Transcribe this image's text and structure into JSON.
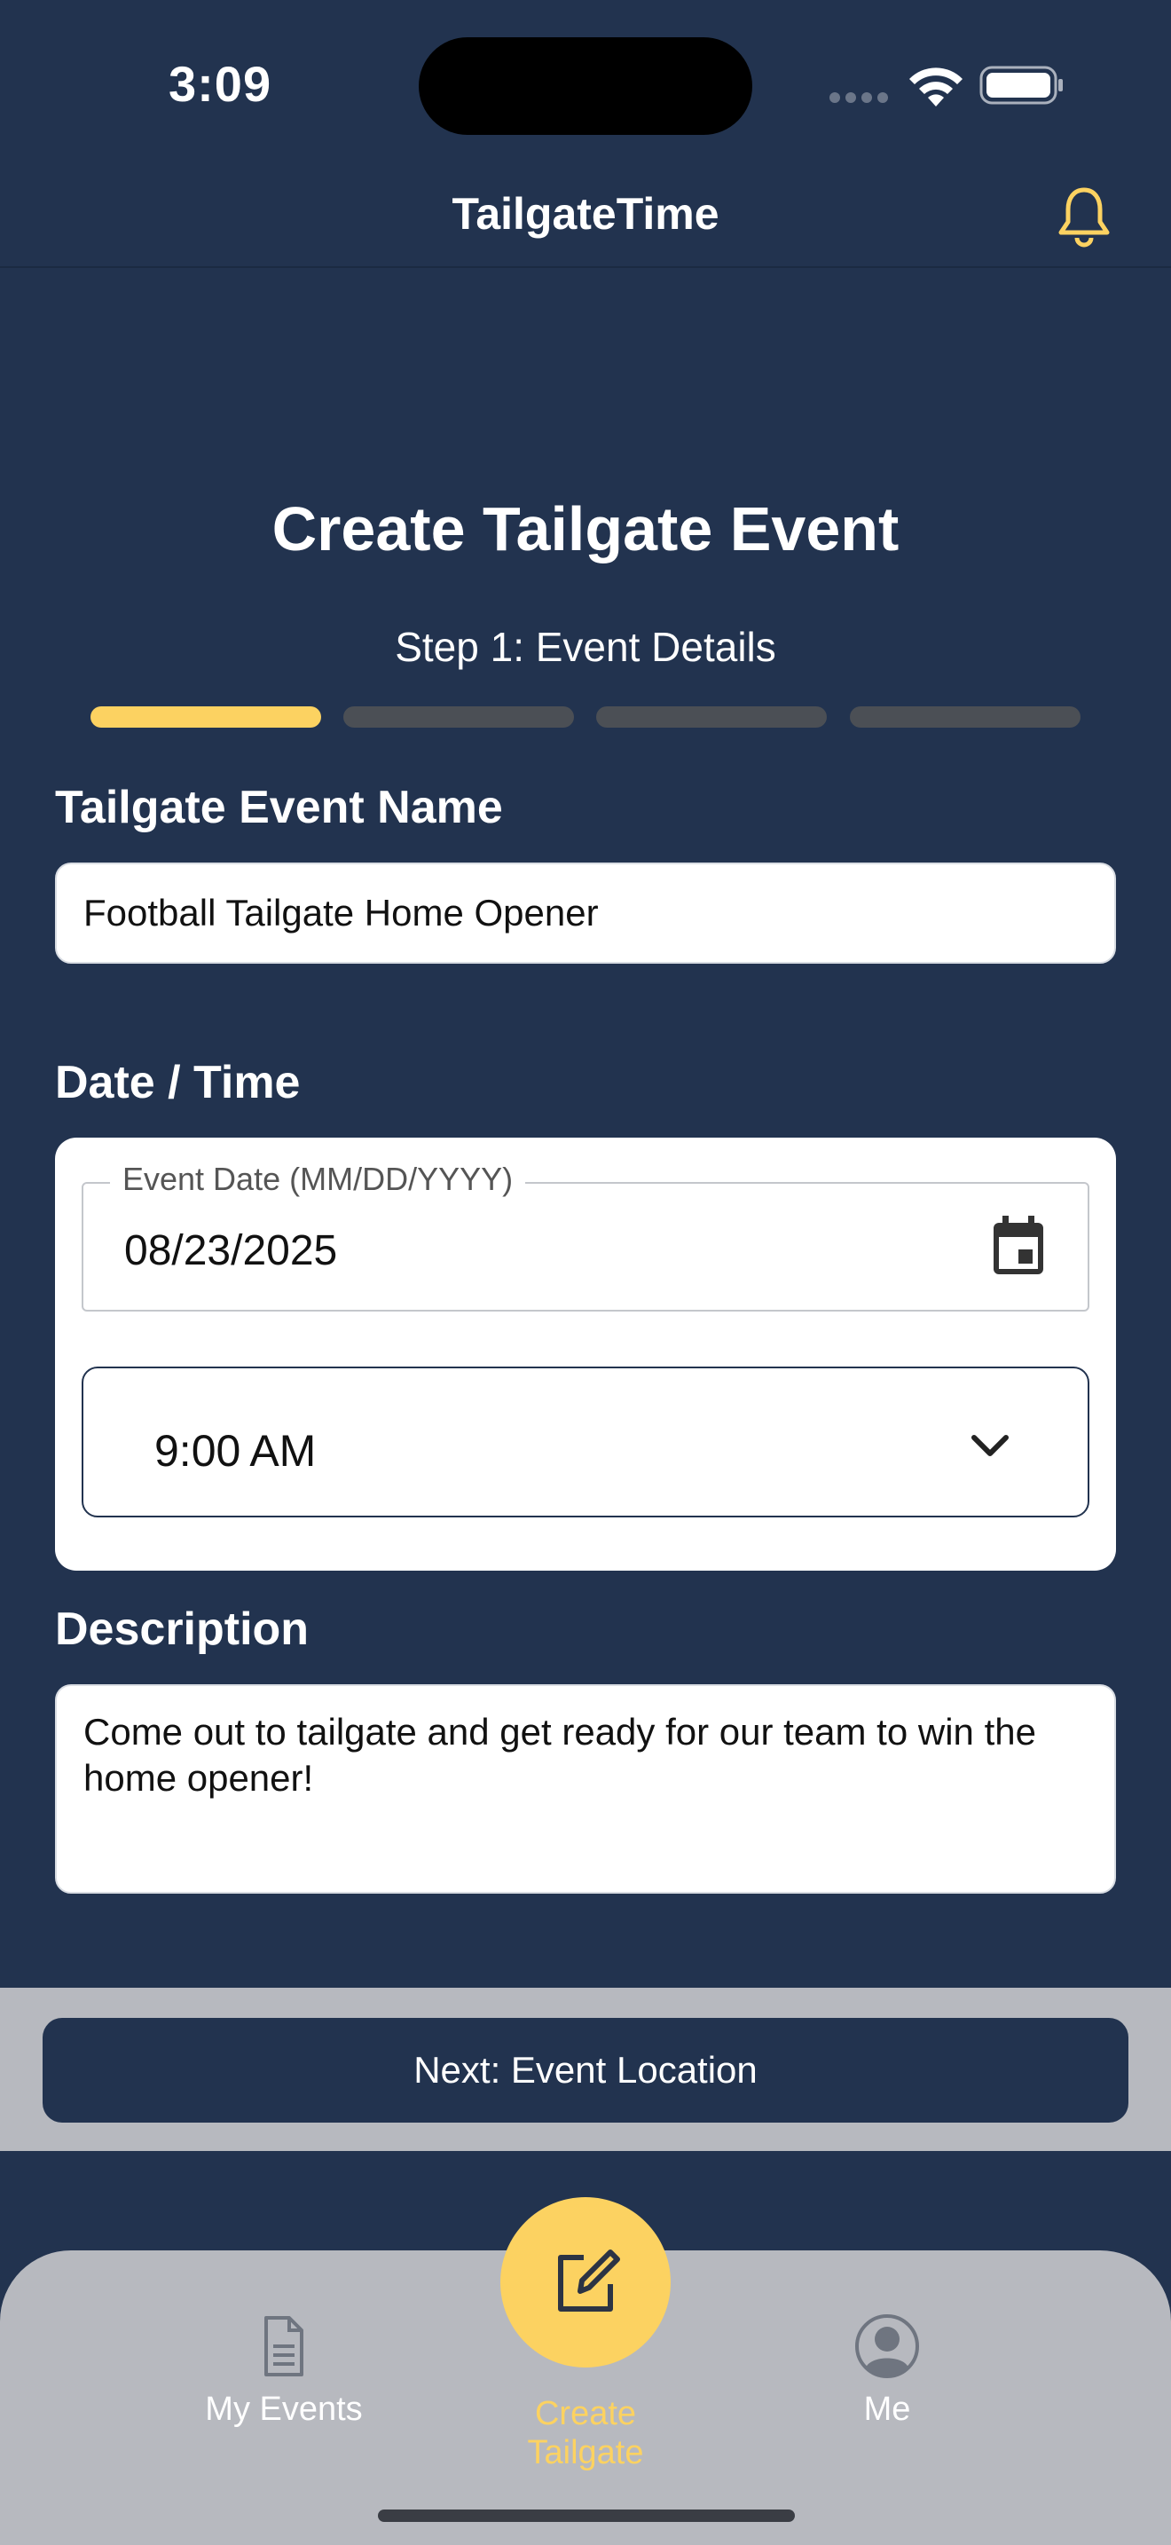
{
  "status_bar": {
    "time": "3:09"
  },
  "header": {
    "title": "TailgateTime",
    "notification_icon": "bell-icon"
  },
  "page": {
    "title": "Create Tailgate Event",
    "step_label": "Step 1: Event Details"
  },
  "progress": {
    "total_steps": 4,
    "current_step": 1,
    "active_color": "#fcd261",
    "inactive_color": "#4b4f55"
  },
  "form": {
    "name_label": "Tailgate Event Name",
    "name_value": "Football Tailgate Home Opener",
    "datetime_label": "Date / Time",
    "date_legend": "Event Date (MM/DD/YYYY)",
    "date_value": "08/23/2025",
    "time_value": "9:00 AM",
    "description_label": "Description",
    "description_value": "Come out to tailgate and get ready for our team to win the home opener!"
  },
  "actions": {
    "next_label": "Next: Event Location"
  },
  "tabs": {
    "my_events": "My Events",
    "create": "Create Tailgate",
    "me": "Me"
  },
  "colors": {
    "background": "#22334f",
    "accent": "#fcd261",
    "tab_bar": "#b7b9bf"
  }
}
